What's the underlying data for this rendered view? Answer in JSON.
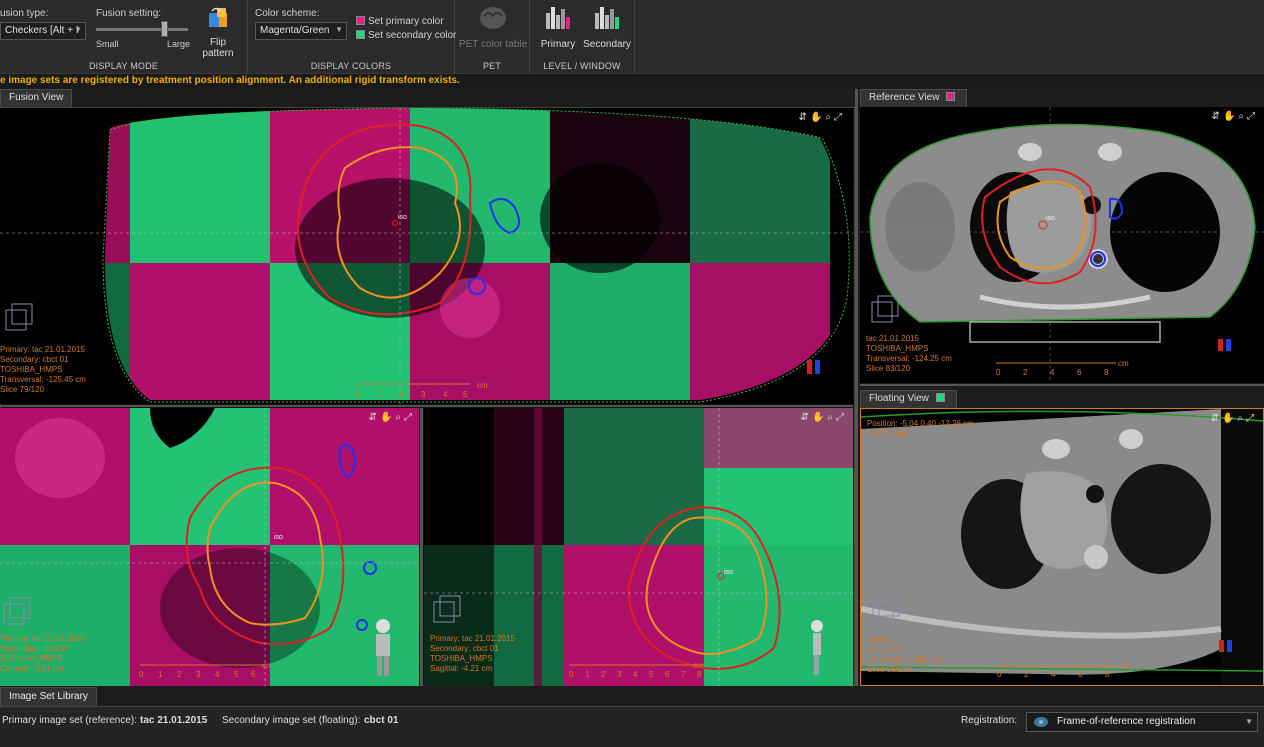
{
  "ribbon": {
    "display_mode": {
      "title": "DISPLAY MODE",
      "fusion_type_label": "usion type:",
      "fusion_type_value": "Checkers [Alt + I",
      "fusion_setting_label": "Fusion setting:",
      "slider_min": "Small",
      "slider_max": "Large",
      "flip_label": "Flip pattern"
    },
    "display_colors": {
      "title": "DISPLAY COLORS",
      "scheme_label": "Color scheme:",
      "scheme_value": "Magenta/Green",
      "primary_label": "Set primary color",
      "secondary_label": "Set secondary color",
      "primary_color": "#e8208a",
      "secondary_color": "#20d880"
    },
    "pet": {
      "title": "PET",
      "table_label": "PET color table"
    },
    "level_window": {
      "title": "LEVEL / WINDOW",
      "primary_label": "Primary",
      "secondary_label": "Secondary"
    }
  },
  "warning": "e image sets are registered by treatment position alignment. An additional rigid transform exists.",
  "fusion_view": {
    "tab": "Fusion View",
    "transversal": {
      "lines": [
        "Primary: tac 21.01.2015",
        "Secondary: cbct 01",
        "TOSHIBA_HMPS",
        "Transversal: -125.45 cm",
        "Slice 79/120"
      ],
      "scale_ticks": [
        "0",
        "1",
        "2",
        "3",
        "4",
        "5"
      ],
      "scale_unit": "cm",
      "iso": "iso"
    },
    "coronal": {
      "lines": [
        "Primary: tac 21.01.2015",
        "Secondary: cbct 01",
        "TOSHIBA_HMPS",
        "Coronal: -2.01 cm"
      ],
      "scale_ticks": [
        "0",
        "1",
        "2",
        "3",
        "4",
        "5",
        "6"
      ],
      "scale_unit": "cm",
      "iso": "iso"
    },
    "sagittal": {
      "lines": [
        "Primary: tac 21.01.2015",
        "Secondary: cbct 01",
        "TOSHIBA_HMPS",
        "Sagittal: -4.21 cm"
      ],
      "scale_ticks": [
        "0",
        "1",
        "2",
        "3",
        "4",
        "5",
        "6",
        "7",
        "8"
      ],
      "scale_unit": "cm",
      "iso": "iso"
    }
  },
  "reference_view": {
    "tab": "Reference View",
    "lines": [
      "tac 21.01.2015",
      "TOSHIBA_HMPS",
      "Transversal: -124.25 cm",
      "Slice 83/120"
    ],
    "scale_ticks": [
      "0",
      "2",
      "4",
      "6",
      "8"
    ],
    "scale_unit": "cm",
    "iso": "iso"
  },
  "floating_view": {
    "tab": "Floating View",
    "top_lines": [
      "Position: -5.04 0.40 -12.26 cm",
      "CBCT: -664"
    ],
    "lines": [
      "cbct 01",
      "Elekta XVI",
      "Transversal: 0.40 cm",
      "Slice 66/128"
    ],
    "scale_ticks": [
      "0",
      "2",
      "4",
      "6",
      "8"
    ],
    "scale_unit": "cm"
  },
  "library_tab": "Image Set Library",
  "status": {
    "primary_label": "Primary image set (reference):",
    "primary_value": "tac 21.01.2015",
    "secondary_label": "Secondary image set (floating):",
    "secondary_value": "cbct 01",
    "registration_label": "Registration:",
    "registration_value": "Frame-of-reference registration"
  }
}
